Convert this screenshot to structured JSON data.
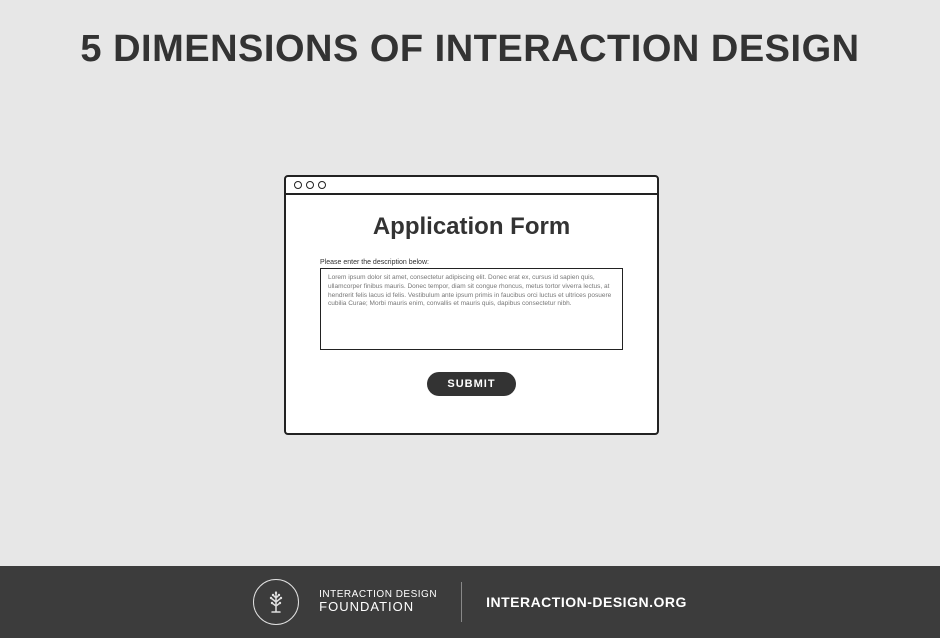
{
  "title": "5 DIMENSIONS OF INTERACTION DESIGN",
  "window": {
    "form_title": "Application Form",
    "label": "Please enter the description below:",
    "textarea_content": "Lorem ipsum dolor sit amet, consectetur adipiscing elit. Donec erat ex, cursus id sapien quis, ullamcorper finibus mauris. Donec tempor, diam sit congue rhoncus, metus tortor viverra lectus, at hendrerit felis lacus id felis. Vestibulum ante ipsum primis in faucibus orci luctus et ultrices posuere cubilia Curae; Morbi mauris enim, convallis et mauris quis, dapibus consectetur nibh.",
    "submit_label": "SUBMIT"
  },
  "footer": {
    "org_line1": "INTERACTION DESIGN",
    "org_line2": "FOUNDATION",
    "url": "INTERACTION-DESIGN.ORG"
  }
}
